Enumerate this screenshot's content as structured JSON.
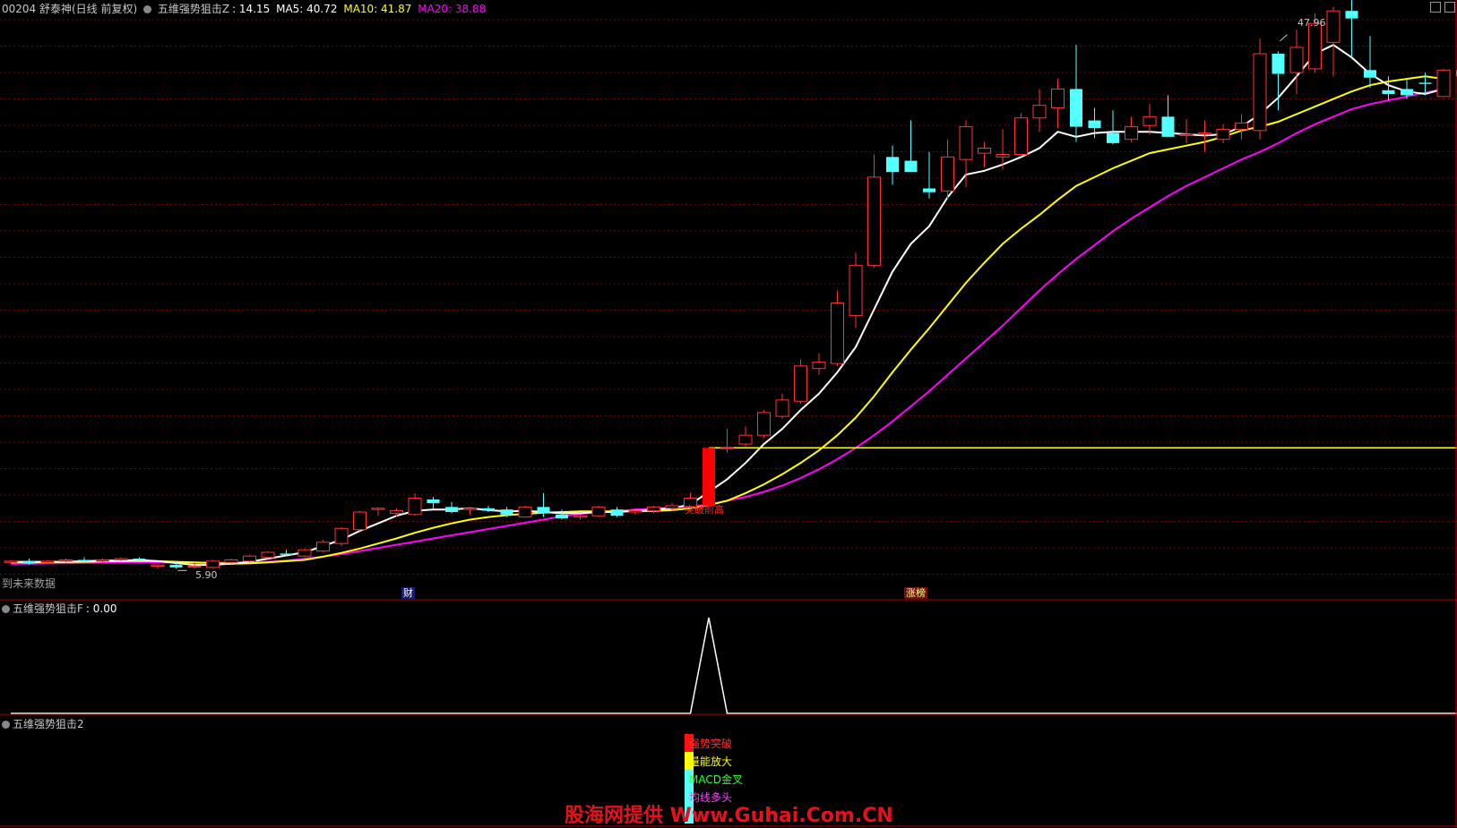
{
  "header": {
    "code_title": "00204 舒泰神(日线 前复权)",
    "indicator_name": "五维强势狙击Z",
    "indicator_value": ": 14.15",
    "ma5_label": "MA5: 40.72",
    "ma10_label": "MA10: 41.87",
    "ma20_label": "MA20: 38.88"
  },
  "colors": {
    "up": "#ff3232",
    "down": "#54ffff",
    "ma5": "#ffffff",
    "ma10": "#ffff00",
    "ma20": "#ff00ff",
    "grid": "#7a0000",
    "signal": "#ff0000",
    "hline": "#ffff00"
  },
  "annotations": {
    "high_label": "47.96",
    "low_label": "5.90",
    "future_data_text": "到未来数据",
    "breakout_label": "突破前高",
    "tag_finance": "财",
    "tag_limit_up": "涨榜"
  },
  "indicator1": {
    "title": "五维强势狙击F",
    "value": ": 0.00"
  },
  "indicator2": {
    "title": "五维强势狙击2",
    "signals": [
      "强势突破",
      "量能放大",
      "MACD金叉",
      "均线多头"
    ]
  },
  "watermark": "股海网提供 Www.Guhai.Com.CN",
  "chart_data": {
    "type": "candlestick",
    "price_range": [
      4.5,
      50
    ],
    "candles": [
      {
        "o": 6.4,
        "h": 6.6,
        "l": 6.3,
        "c": 6.5
      },
      {
        "o": 6.5,
        "h": 6.7,
        "l": 6.2,
        "c": 6.3
      },
      {
        "o": 6.4,
        "h": 6.6,
        "l": 6.3,
        "c": 6.5
      },
      {
        "o": 6.5,
        "h": 6.7,
        "l": 6.4,
        "c": 6.6
      },
      {
        "o": 6.6,
        "h": 6.8,
        "l": 6.5,
        "c": 6.5
      },
      {
        "o": 6.5,
        "h": 6.7,
        "l": 6.4,
        "c": 6.6
      },
      {
        "o": 6.6,
        "h": 6.8,
        "l": 6.5,
        "c": 6.7
      },
      {
        "o": 6.7,
        "h": 6.8,
        "l": 6.5,
        "c": 6.6
      },
      {
        "o": 6.1,
        "h": 6.2,
        "l": 5.9,
        "c": 6.2
      },
      {
        "o": 6.2,
        "h": 6.4,
        "l": 5.9,
        "c": 6.0
      },
      {
        "o": 6.1,
        "h": 6.4,
        "l": 5.9,
        "c": 6.1
      },
      {
        "o": 6.0,
        "h": 6.6,
        "l": 5.9,
        "c": 6.5
      },
      {
        "o": 6.4,
        "h": 6.7,
        "l": 6.3,
        "c": 6.6
      },
      {
        "o": 6.5,
        "h": 7.0,
        "l": 6.4,
        "c": 6.9
      },
      {
        "o": 6.8,
        "h": 7.3,
        "l": 6.7,
        "c": 7.2
      },
      {
        "o": 7.1,
        "h": 7.4,
        "l": 6.9,
        "c": 7.0
      },
      {
        "o": 6.9,
        "h": 7.5,
        "l": 6.8,
        "c": 7.4
      },
      {
        "o": 7.3,
        "h": 8.2,
        "l": 7.2,
        "c": 8.0
      },
      {
        "o": 7.9,
        "h": 9.2,
        "l": 7.7,
        "c": 9.1
      },
      {
        "o": 9.0,
        "h": 10.5,
        "l": 8.9,
        "c": 10.4
      },
      {
        "o": 10.6,
        "h": 10.8,
        "l": 10.1,
        "c": 10.7
      },
      {
        "o": 10.3,
        "h": 10.7,
        "l": 10.0,
        "c": 10.5
      },
      {
        "o": 10.2,
        "h": 11.9,
        "l": 10.1,
        "c": 11.5
      },
      {
        "o": 11.4,
        "h": 11.6,
        "l": 10.6,
        "c": 11.1
      },
      {
        "o": 10.8,
        "h": 11.2,
        "l": 10.3,
        "c": 10.4
      },
      {
        "o": 10.6,
        "h": 10.8,
        "l": 10.2,
        "c": 10.7
      },
      {
        "o": 10.7,
        "h": 10.9,
        "l": 10.4,
        "c": 10.5
      },
      {
        "o": 10.6,
        "h": 10.8,
        "l": 10.0,
        "c": 10.2
      },
      {
        "o": 10.0,
        "h": 10.9,
        "l": 10.0,
        "c": 10.8
      },
      {
        "o": 10.8,
        "h": 11.9,
        "l": 10.0,
        "c": 10.3
      },
      {
        "o": 10.2,
        "h": 10.6,
        "l": 9.8,
        "c": 9.9
      },
      {
        "o": 10.0,
        "h": 10.2,
        "l": 9.8,
        "c": 10.1
      },
      {
        "o": 10.1,
        "h": 10.9,
        "l": 10.0,
        "c": 10.8
      },
      {
        "o": 10.6,
        "h": 10.8,
        "l": 10.0,
        "c": 10.1
      },
      {
        "o": 10.4,
        "h": 10.7,
        "l": 10.2,
        "c": 10.5
      },
      {
        "o": 10.5,
        "h": 10.9,
        "l": 10.3,
        "c": 10.8
      },
      {
        "o": 10.7,
        "h": 11.1,
        "l": 10.5,
        "c": 10.9
      },
      {
        "o": 10.8,
        "h": 11.9,
        "l": 10.7,
        "c": 11.5
      },
      {
        "o": 10.9,
        "h": 15.5,
        "l": 10.7,
        "c": 15.5
      },
      {
        "o": 15.5,
        "h": 17.0,
        "l": 15.1,
        "c": 15.5
      },
      {
        "o": 15.8,
        "h": 17.2,
        "l": 15.6,
        "c": 16.5
      },
      {
        "o": 16.5,
        "h": 18.5,
        "l": 16.3,
        "c": 18.3
      },
      {
        "o": 18.0,
        "h": 19.8,
        "l": 17.8,
        "c": 19.3
      },
      {
        "o": 19.2,
        "h": 22.5,
        "l": 19.0,
        "c": 22.0
      },
      {
        "o": 21.8,
        "h": 23.0,
        "l": 21.3,
        "c": 22.3
      },
      {
        "o": 22.2,
        "h": 28.0,
        "l": 22.0,
        "c": 27.0
      },
      {
        "o": 26.0,
        "h": 31.0,
        "l": 25.0,
        "c": 30.0
      },
      {
        "o": 30.0,
        "h": 38.8,
        "l": 29.8,
        "c": 37.0
      },
      {
        "o": 38.6,
        "h": 39.5,
        "l": 36.4,
        "c": 37.4
      },
      {
        "o": 38.3,
        "h": 41.5,
        "l": 37.6,
        "c": 37.4
      },
      {
        "o": 36.1,
        "h": 39.0,
        "l": 35.3,
        "c": 35.8
      },
      {
        "o": 35.9,
        "h": 40.0,
        "l": 35.2,
        "c": 38.6
      },
      {
        "o": 38.4,
        "h": 41.5,
        "l": 36.2,
        "c": 41.0
      },
      {
        "o": 38.9,
        "h": 39.8,
        "l": 37.8,
        "c": 39.3
      },
      {
        "o": 38.6,
        "h": 40.8,
        "l": 37.6,
        "c": 38.8
      },
      {
        "o": 38.8,
        "h": 42.1,
        "l": 38.6,
        "c": 41.7
      },
      {
        "o": 41.7,
        "h": 44.0,
        "l": 40.6,
        "c": 42.7
      },
      {
        "o": 42.5,
        "h": 44.8,
        "l": 40.9,
        "c": 44.0
      },
      {
        "o": 44.0,
        "h": 47.5,
        "l": 39.8,
        "c": 41.0
      },
      {
        "o": 41.5,
        "h": 42.5,
        "l": 40.1,
        "c": 40.9
      },
      {
        "o": 40.5,
        "h": 42.3,
        "l": 39.6,
        "c": 39.7
      },
      {
        "o": 40.0,
        "h": 41.8,
        "l": 39.8,
        "c": 41.0
      },
      {
        "o": 41.1,
        "h": 42.8,
        "l": 40.4,
        "c": 41.8
      },
      {
        "o": 41.8,
        "h": 43.5,
        "l": 41.3,
        "c": 40.2
      },
      {
        "o": 40.3,
        "h": 41.6,
        "l": 39.7,
        "c": 40.4
      },
      {
        "o": 40.4,
        "h": 41.5,
        "l": 39.0,
        "c": 40.5
      },
      {
        "o": 40.0,
        "h": 41.2,
        "l": 39.7,
        "c": 40.8
      },
      {
        "o": 40.8,
        "h": 42.0,
        "l": 40.0,
        "c": 41.3
      },
      {
        "o": 40.7,
        "h": 48.0,
        "l": 40.0,
        "c": 46.8
      },
      {
        "o": 46.8,
        "h": 47.0,
        "l": 42.3,
        "c": 45.2
      },
      {
        "o": 45.3,
        "h": 48.7,
        "l": 43.6,
        "c": 47.3
      },
      {
        "o": 45.6,
        "h": 50.0,
        "l": 45.3,
        "c": 49.2
      },
      {
        "o": 47.7,
        "h": 50.5,
        "l": 45.0,
        "c": 50.2
      },
      {
        "o": 50.2,
        "h": 51.5,
        "l": 46.5,
        "c": 49.6
      },
      {
        "o": 45.5,
        "h": 48.2,
        "l": 44.1,
        "c": 44.9
      },
      {
        "o": 43.9,
        "h": 45.0,
        "l": 43.1,
        "c": 43.6
      },
      {
        "o": 44.0,
        "h": 44.7,
        "l": 43.2,
        "c": 43.5
      },
      {
        "o": 44.5,
        "h": 45.3,
        "l": 43.5,
        "c": 44.4
      },
      {
        "o": 43.4,
        "h": 45.6,
        "l": 43.4,
        "c": 45.5
      },
      {
        "o": 45.5,
        "h": 46.1,
        "l": 44.4,
        "c": 45.0
      }
    ],
    "ma5": [
      6.45,
      6.45,
      6.45,
      6.45,
      6.5,
      6.55,
      6.55,
      6.6,
      6.5,
      6.35,
      6.2,
      6.2,
      6.3,
      6.45,
      6.7,
      6.95,
      7.2,
      7.7,
      8.2,
      8.9,
      9.5,
      10.1,
      10.5,
      10.6,
      10.6,
      10.7,
      10.55,
      10.45,
      10.5,
      10.4,
      10.3,
      10.3,
      10.4,
      10.4,
      10.5,
      10.6,
      10.7,
      11.0,
      12.0,
      13.0,
      14.3,
      15.8,
      17.0,
      18.5,
      19.8,
      21.5,
      23.5,
      26.5,
      29.5,
      31.7,
      33.1,
      35.4,
      37.2,
      37.5,
      38.0,
      38.6,
      39.3,
      40.6,
      40.2,
      40.5,
      40.6,
      40.6,
      40.6,
      40.5,
      40.4,
      40.3,
      40.4,
      41.0,
      42.0,
      43.3,
      45.0,
      46.8,
      47.5,
      46.5,
      45.2,
      44.3,
      43.8,
      43.6,
      44.0
    ],
    "ma10": [
      6.4,
      6.4,
      6.42,
      6.44,
      6.45,
      6.48,
      6.5,
      6.52,
      6.5,
      6.45,
      6.4,
      6.35,
      6.3,
      6.32,
      6.4,
      6.5,
      6.6,
      6.85,
      7.15,
      7.5,
      7.9,
      8.3,
      8.75,
      9.15,
      9.5,
      9.8,
      10.0,
      10.15,
      10.25,
      10.35,
      10.4,
      10.45,
      10.45,
      10.45,
      10.45,
      10.48,
      10.55,
      10.7,
      10.95,
      11.3,
      11.9,
      12.6,
      13.4,
      14.3,
      15.3,
      16.5,
      17.9,
      19.6,
      21.5,
      23.3,
      25.0,
      26.8,
      28.6,
      30.2,
      31.7,
      32.9,
      34.0,
      35.2,
      36.3,
      37.0,
      37.7,
      38.3,
      38.9,
      39.2,
      39.5,
      39.8,
      40.2,
      40.7,
      41.0,
      41.4,
      42.0,
      42.6,
      43.2,
      43.8,
      44.3,
      44.6,
      44.8,
      45.0,
      44.8
    ],
    "ma20": [
      6.3,
      6.3,
      6.32,
      6.34,
      6.36,
      6.38,
      6.4,
      6.42,
      6.4,
      6.38,
      6.36,
      6.36,
      6.38,
      6.4,
      6.45,
      6.55,
      6.7,
      6.85,
      7.05,
      7.3,
      7.55,
      7.8,
      8.05,
      8.3,
      8.55,
      8.8,
      9.05,
      9.3,
      9.55,
      9.8,
      10.05,
      10.25,
      10.4,
      10.5,
      10.6,
      10.68,
      10.75,
      10.85,
      11.0,
      11.3,
      11.6,
      12.0,
      12.5,
      13.1,
      13.8,
      14.6,
      15.5,
      16.5,
      17.6,
      18.8,
      20.0,
      21.3,
      22.6,
      23.9,
      25.2,
      26.6,
      28.0,
      29.3,
      30.5,
      31.6,
      32.7,
      33.7,
      34.6,
      35.5,
      36.3,
      37.0,
      37.7,
      38.4,
      39.0,
      39.7,
      40.5,
      41.2,
      41.8,
      42.4,
      42.8,
      43.1,
      43.4,
      43.7,
      44.0
    ],
    "breakout_index": 38,
    "breakout_level": 15.5,
    "high": 47.96,
    "low": 5.9
  }
}
